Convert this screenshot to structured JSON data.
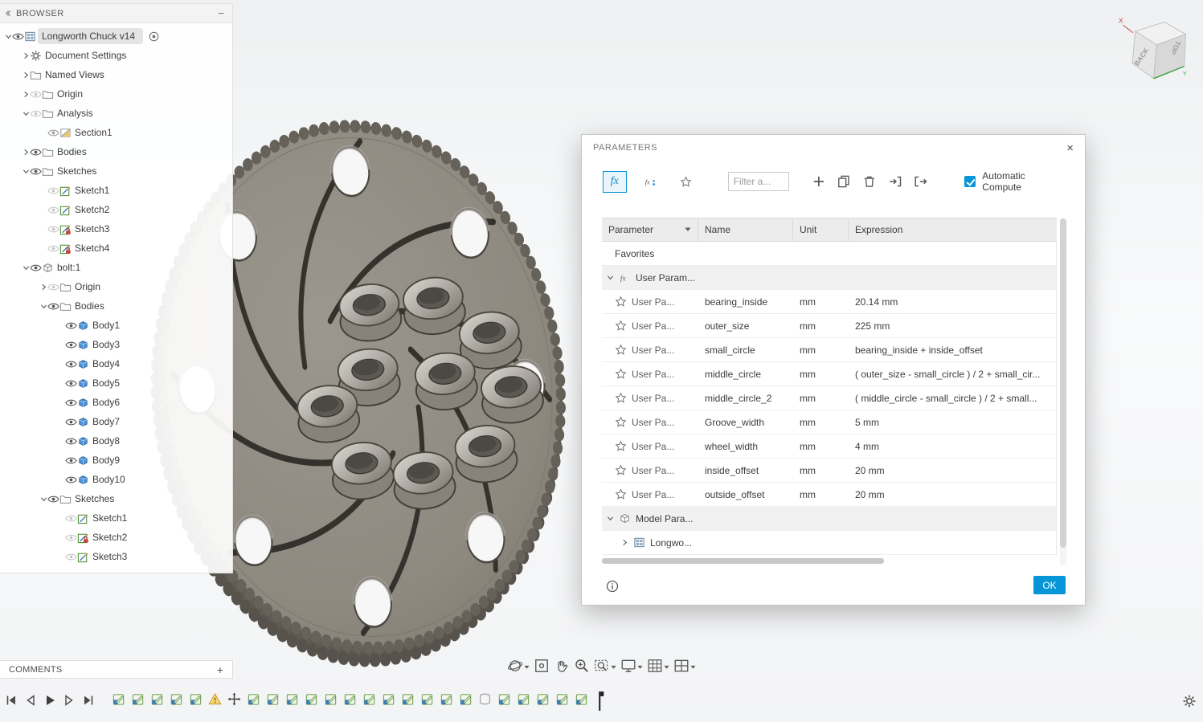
{
  "colors": {
    "accent": "#0696d7"
  },
  "browser": {
    "header": "BROWSER",
    "minimize_glyph": "−",
    "items": [
      {
        "level": 0,
        "chevron": "down",
        "eye": "visible",
        "icon": "document",
        "label": "Longworth Chuck v14",
        "root": true,
        "radio": true
      },
      {
        "level": 1,
        "chevron": "right",
        "icon": "gear",
        "label": "Document Settings"
      },
      {
        "level": 1,
        "chevron": "right",
        "icon": "folder",
        "label": "Named Views"
      },
      {
        "level": 1,
        "chevron": "right",
        "eye": "hidden",
        "icon": "folder",
        "label": "Origin"
      },
      {
        "level": 1,
        "chevron": "down",
        "eye": "hidden",
        "icon": "folder",
        "label": "Analysis"
      },
      {
        "level": 2,
        "eye": "dim",
        "icon": "section",
        "label": "Section1"
      },
      {
        "level": 1,
        "chevron": "right",
        "eye": "visible",
        "icon": "folder",
        "label": "Bodies"
      },
      {
        "level": 1,
        "chevron": "down",
        "eye": "visible",
        "icon": "folder",
        "label": "Sketches"
      },
      {
        "level": 2,
        "eye": "hidden",
        "icon": "sketch",
        "label": "Sketch1"
      },
      {
        "level": 2,
        "eye": "hidden",
        "icon": "sketch",
        "label": "Sketch2"
      },
      {
        "level": 2,
        "eye": "hidden",
        "icon": "sketch-lock",
        "label": "Sketch3"
      },
      {
        "level": 2,
        "eye": "hidden",
        "icon": "sketch-lock",
        "label": "Sketch4"
      },
      {
        "level": 1,
        "chevron": "down",
        "eye": "visible",
        "icon": "component",
        "label": "bolt:1"
      },
      {
        "level": 2,
        "chevron": "right",
        "eye": "hidden",
        "icon": "folder",
        "label": "Origin"
      },
      {
        "level": 2,
        "chevron": "down",
        "eye": "visible",
        "icon": "folder",
        "label": "Bodies"
      },
      {
        "level": 3,
        "eye": "visible",
        "icon": "body",
        "label": "Body1"
      },
      {
        "level": 3,
        "eye": "visible",
        "icon": "body",
        "label": "Body3"
      },
      {
        "level": 3,
        "eye": "visible",
        "icon": "body",
        "label": "Body4"
      },
      {
        "level": 3,
        "eye": "visible",
        "icon": "body",
        "label": "Body5"
      },
      {
        "level": 3,
        "eye": "visible",
        "icon": "body",
        "label": "Body6"
      },
      {
        "level": 3,
        "eye": "visible",
        "icon": "body",
        "label": "Body7"
      },
      {
        "level": 3,
        "eye": "visible",
        "icon": "body",
        "label": "Body8"
      },
      {
        "level": 3,
        "eye": "visible",
        "icon": "body",
        "label": "Body9"
      },
      {
        "level": 3,
        "eye": "visible",
        "icon": "body",
        "label": "Body10"
      },
      {
        "level": 2,
        "chevron": "down",
        "eye": "visible",
        "icon": "folder",
        "label": "Sketches"
      },
      {
        "level": 3,
        "eye": "hidden",
        "icon": "sketch",
        "label": "Sketch1"
      },
      {
        "level": 3,
        "eye": "hidden",
        "icon": "sketch-lock",
        "label": "Sketch2"
      },
      {
        "level": 3,
        "eye": "hidden",
        "icon": "sketch",
        "label": "Sketch3"
      }
    ]
  },
  "dialog": {
    "title": "PARAMETERS",
    "close_glyph": "×",
    "toolbar": {
      "fx_label": "fx",
      "filter_placeholder": "Filter a...",
      "auto_compute_label": "Automatic Compute"
    },
    "table": {
      "columns": [
        "Parameter",
        "Name",
        "Unit",
        "Expression"
      ],
      "favorites_label": "Favorites",
      "user_section_label": "User Param...",
      "model_section_label": "Model Para...",
      "model_child_label": "Longwo...",
      "rows": [
        {
          "param": "User Pa...",
          "name": "bearing_inside",
          "unit": "mm",
          "expression": "20.14 mm"
        },
        {
          "param": "User Pa...",
          "name": "outer_size",
          "unit": "mm",
          "expression": "225 mm"
        },
        {
          "param": "User Pa...",
          "name": "small_circle",
          "unit": "mm",
          "expression": "bearing_inside + inside_offset"
        },
        {
          "param": "User Pa...",
          "name": "middle_circle",
          "unit": "mm",
          "expression": "( outer_size - small_circle ) / 2 + small_cir..."
        },
        {
          "param": "User Pa...",
          "name": "middle_circle_2",
          "unit": "mm",
          "expression": "( middle_circle - small_circle ) / 2 + small..."
        },
        {
          "param": "User Pa...",
          "name": "Groove_width",
          "unit": "mm",
          "expression": "5 mm"
        },
        {
          "param": "User Pa...",
          "name": "wheel_width",
          "unit": "mm",
          "expression": "4 mm"
        },
        {
          "param": "User Pa...",
          "name": "inside_offset",
          "unit": "mm",
          "expression": "20 mm"
        },
        {
          "param": "User Pa...",
          "name": "outside_offset",
          "unit": "mm",
          "expression": "20 mm"
        }
      ]
    },
    "ok_label": "OK"
  },
  "comments": {
    "header": "COMMENTS",
    "add_glyph": "+"
  },
  "viewcube": {
    "back_label": "BACK",
    "top_label": "TOP",
    "x_label": "X",
    "y_label": "Y"
  },
  "timeline": {
    "features": [
      "sketch",
      "sketch",
      "sketch",
      "sketch",
      "sketch",
      "warning",
      "move",
      "sketch",
      "sketch",
      "sketch",
      "sketch",
      "sketch",
      "sketch",
      "sketch",
      "sketch",
      "sketch",
      "sketch",
      "sketch",
      "sketch",
      "cylinder",
      "sketch",
      "sketch",
      "sketch",
      "sketch",
      "sketch"
    ]
  }
}
